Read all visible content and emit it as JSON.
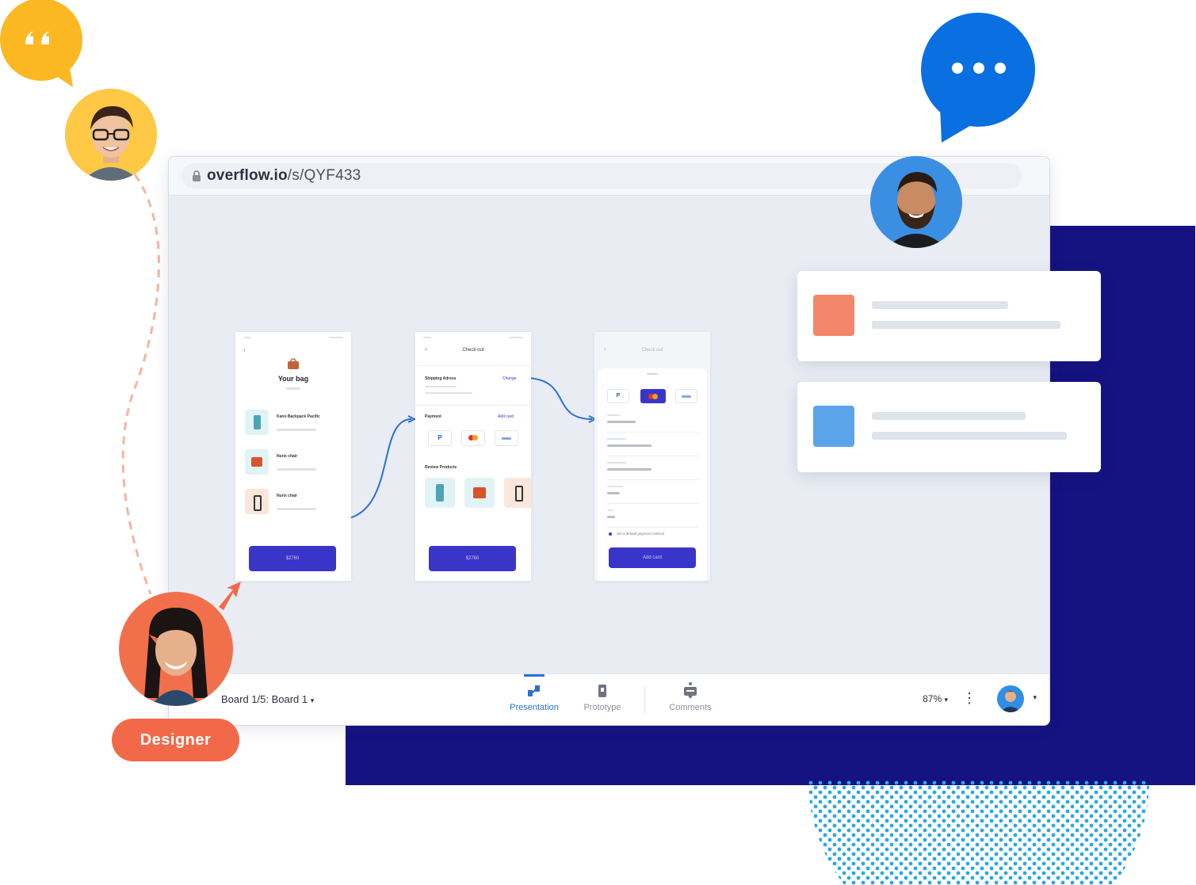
{
  "browser": {
    "url_domain": "overflow.io",
    "url_path": "/s/QYF433"
  },
  "screens": {
    "bag": {
      "title": "Your bag",
      "items": [
        "Kano Backpack Pacific",
        "Nurix chair",
        "Nurix chair"
      ],
      "cta": "$2760"
    },
    "checkout": {
      "title": "Check out",
      "shipping_label": "Shipping Adress",
      "change_link": "Change",
      "payment_label": "Payment",
      "add_link": "Add card",
      "review_label": "Review Products",
      "cta": "$2760"
    },
    "card_entry": {
      "title": "Check out",
      "cta": "Add card",
      "checkbox_label": "Set a default payment method"
    }
  },
  "cards": {
    "top_color": "#f4876a",
    "bottom_color": "#5aa5ea"
  },
  "toolbar": {
    "board_label": "Board 1/5: Board 1",
    "tools": [
      {
        "label": "Presentation",
        "icon": "presentation-icon"
      },
      {
        "label": "Prototype",
        "icon": "prototype-icon"
      },
      {
        "label": "Comments",
        "icon": "comments-icon"
      }
    ],
    "zoom": "87%"
  },
  "badge": {
    "label": "Designer"
  },
  "colors": {
    "navy": "#151282",
    "yellow_bubble": "#fbb823",
    "blue_bubble": "#0a6fe0",
    "accent_orange": "#f26949",
    "primary_button": "#3a35c9",
    "dots": "#2aa7e6"
  }
}
